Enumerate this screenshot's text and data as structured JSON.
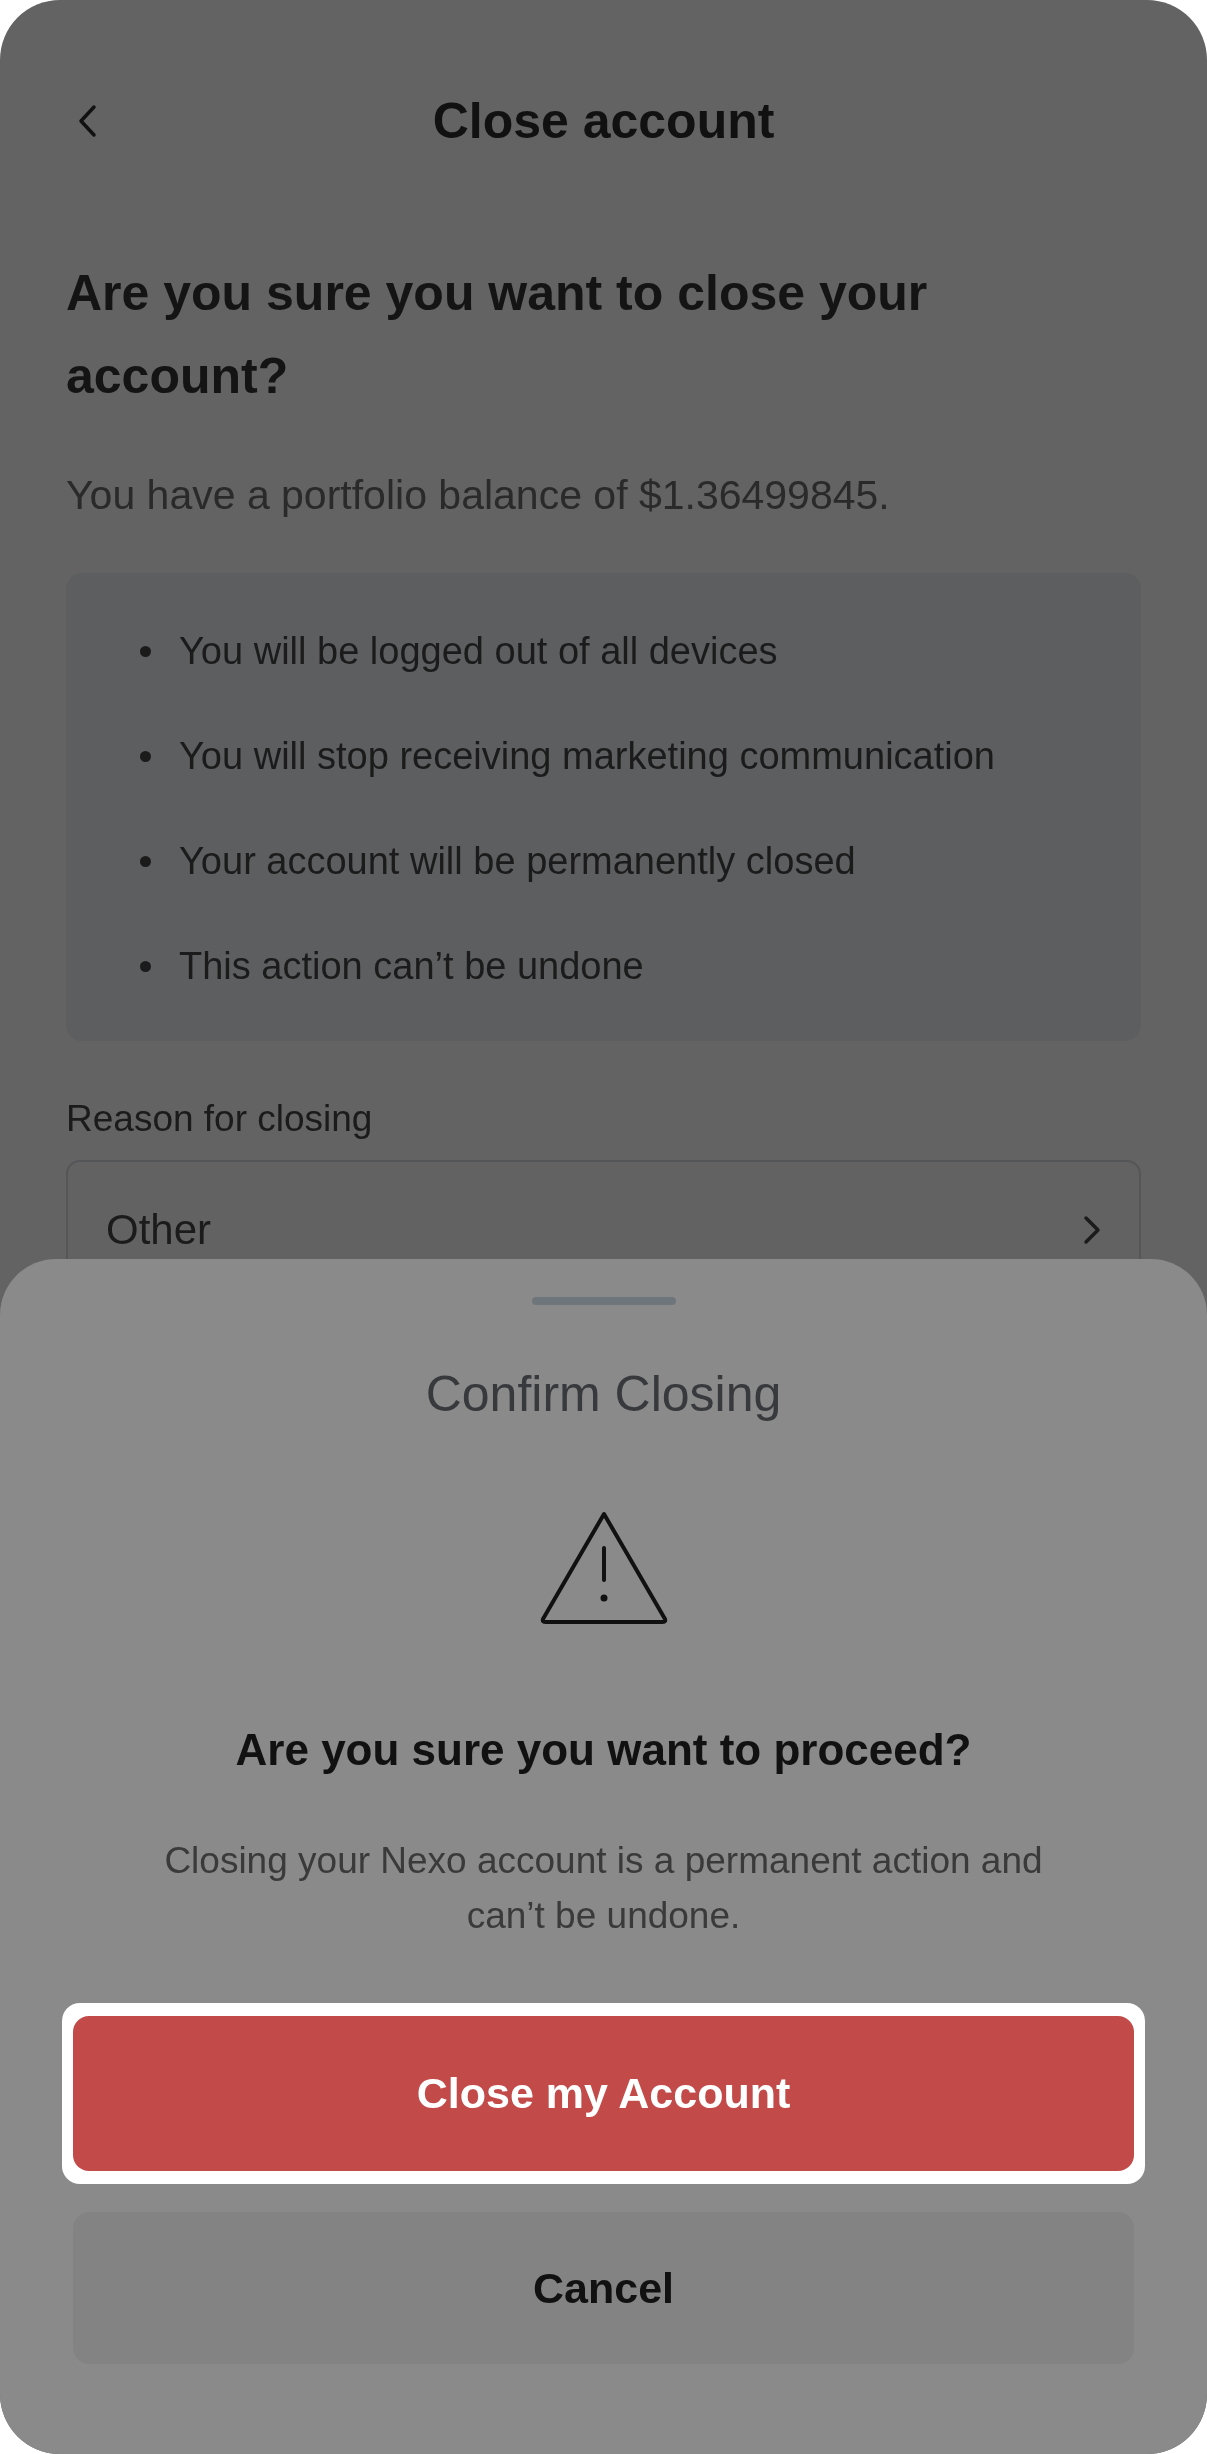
{
  "header": {
    "title": "Close account"
  },
  "heading": "Are you sure you want to close your account?",
  "balance_text": "You have a portfolio balance of $1.36499845.",
  "consequences": [
    "You will be logged out of all devices",
    "You will stop receiving marketing communication",
    "Your account will be permanently closed",
    "This action can’t be undone"
  ],
  "reason": {
    "label": "Reason for closing",
    "value": "Other"
  },
  "dialog": {
    "title": "Confirm Closing",
    "question": "Are you sure you want to proceed?",
    "message": "Closing your Nexo account is a permanent action and can’t be undone.",
    "buttons": [
      {
        "label": "Close my Account",
        "kind": "primary",
        "highlighted": true
      },
      {
        "label": "Cancel",
        "kind": "secondary",
        "highlighted": false
      }
    ]
  }
}
